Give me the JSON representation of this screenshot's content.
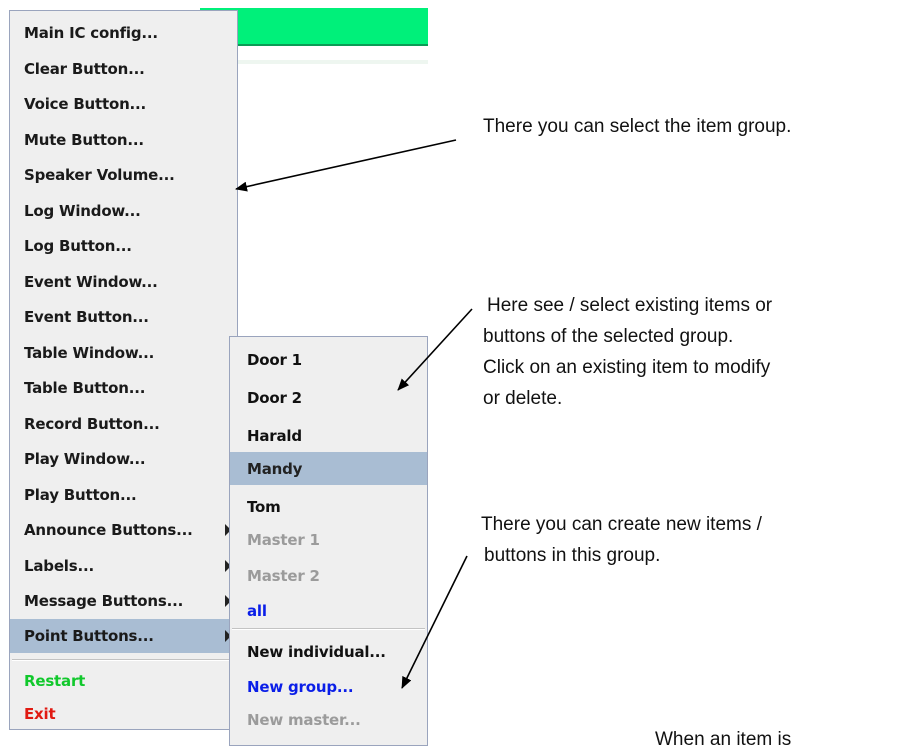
{
  "menu": {
    "items": [
      {
        "label": "Main IC config..."
      },
      {
        "label": "Clear Button..."
      },
      {
        "label": "Voice Button..."
      },
      {
        "label": "Mute Button..."
      },
      {
        "label": "Speaker Volume..."
      },
      {
        "label": "Log Window..."
      },
      {
        "label": "Log Button..."
      },
      {
        "label": "Event Window..."
      },
      {
        "label": "Event Button..."
      },
      {
        "label": "Table Window..."
      },
      {
        "label": "Table Button..."
      },
      {
        "label": "Record Button..."
      },
      {
        "label": "Play Window..."
      },
      {
        "label": "Play Button..."
      },
      {
        "label": "Announce Buttons..."
      },
      {
        "label": "Labels..."
      },
      {
        "label": "Message Buttons..."
      },
      {
        "label": "Point Buttons..."
      }
    ],
    "restart_label": "Restart",
    "exit_label": "Exit",
    "colors": {
      "highlight": "#a9bdd3",
      "restart": "#11c82c",
      "exit": "#e11a12",
      "green_bar": "#00f07a"
    }
  },
  "submenu": {
    "items": [
      {
        "label": "Door 1"
      },
      {
        "label": "Door 2"
      },
      {
        "label": "Harald"
      },
      {
        "label": "Mandy"
      },
      {
        "label": "Tom"
      },
      {
        "label": "Master 1"
      },
      {
        "label": "Master 2"
      },
      {
        "label": "all"
      }
    ],
    "actions": [
      {
        "label": "New individual..."
      },
      {
        "label": "New group..."
      },
      {
        "label": "New master..."
      }
    ],
    "colors": {
      "group": "#0a1ee8",
      "disabled": "#9b9b9b"
    }
  },
  "notes": {
    "item_group": "There you can select the item group.",
    "existing_line1": "Here see / select existing items or",
    "existing_line2": "buttons of the selected group.",
    "existing_line3": "Click on an existing item to modify",
    "existing_line4": "or delete.",
    "create_line1": "There you can create new items /",
    "create_line2": "buttons in this group.",
    "bottom_cut": "When an item is"
  }
}
